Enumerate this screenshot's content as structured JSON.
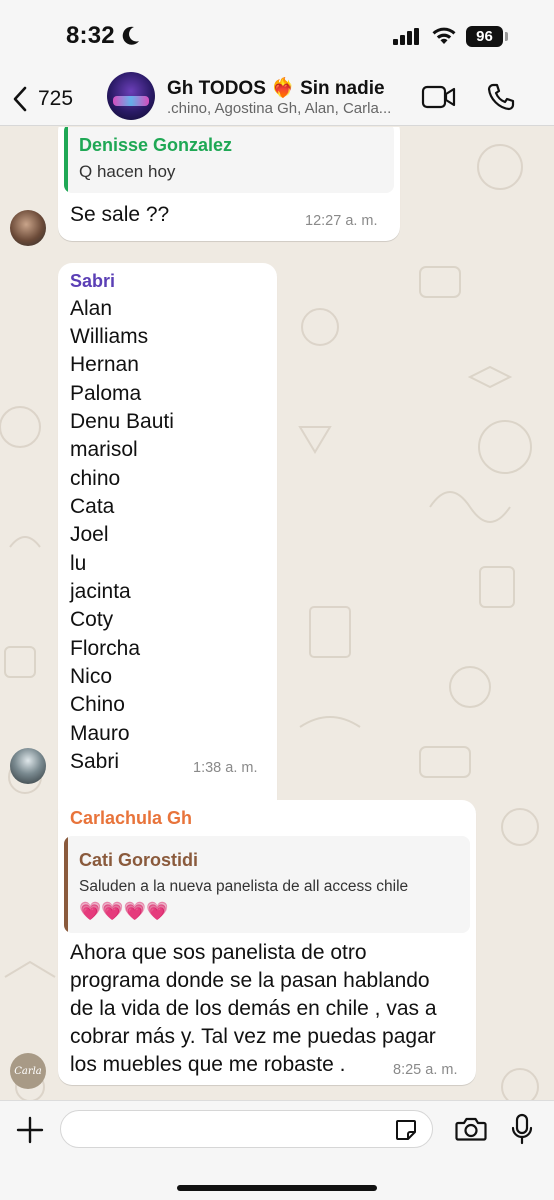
{
  "status": {
    "time": "8:32",
    "battery": "96"
  },
  "header": {
    "back_count": "725",
    "title": "Gh TODOS ❤️‍🔥 Sin nadie",
    "subtitle": ".chino, Agostina Gh, Alan, Carla..."
  },
  "messages": {
    "m1": {
      "reply_sender": "Denisse Gonzalez",
      "reply_text": "Q hacen hoy",
      "text": "Se sale ??",
      "time": "12:27 a. m."
    },
    "m2": {
      "sender": "Sabri",
      "lines": [
        "Alan",
        "Williams",
        "Hernan",
        "Paloma",
        "Denu Bauti",
        "marisol",
        "chino",
        "Cata",
        "Joel",
        "lu",
        "jacinta",
        "Coty",
        "Florcha",
        "Nico",
        "Chino",
        "Mauro",
        "Sabri"
      ],
      "time": "1:38 a. m."
    },
    "m3": {
      "sender": "Carlachula Gh",
      "reply_sender": "Cati Gorostidi",
      "reply_text": "Saluden a la nueva panelista de all access chile",
      "reply_emoji": "💗💗💗💗",
      "line1": "Ahora que sos panelista de otro",
      "line2": "programa donde se la pasan hablando",
      "line3": "de la vida de los demás en chile , vas a",
      "line4": "cobrar más y. Tal vez me puedas pagar",
      "line5": "los muebles que me robaste .",
      "time": "8:25 a. m.",
      "avatar_label": "Carla"
    }
  },
  "input": {
    "value": "",
    "placeholder": ""
  },
  "colors": {
    "chat_bg": "#efeae2",
    "denisse": "#1fa855",
    "sabri": "#5b3fb5",
    "carla": "#e8743b",
    "cati": "#8a5a3c"
  }
}
